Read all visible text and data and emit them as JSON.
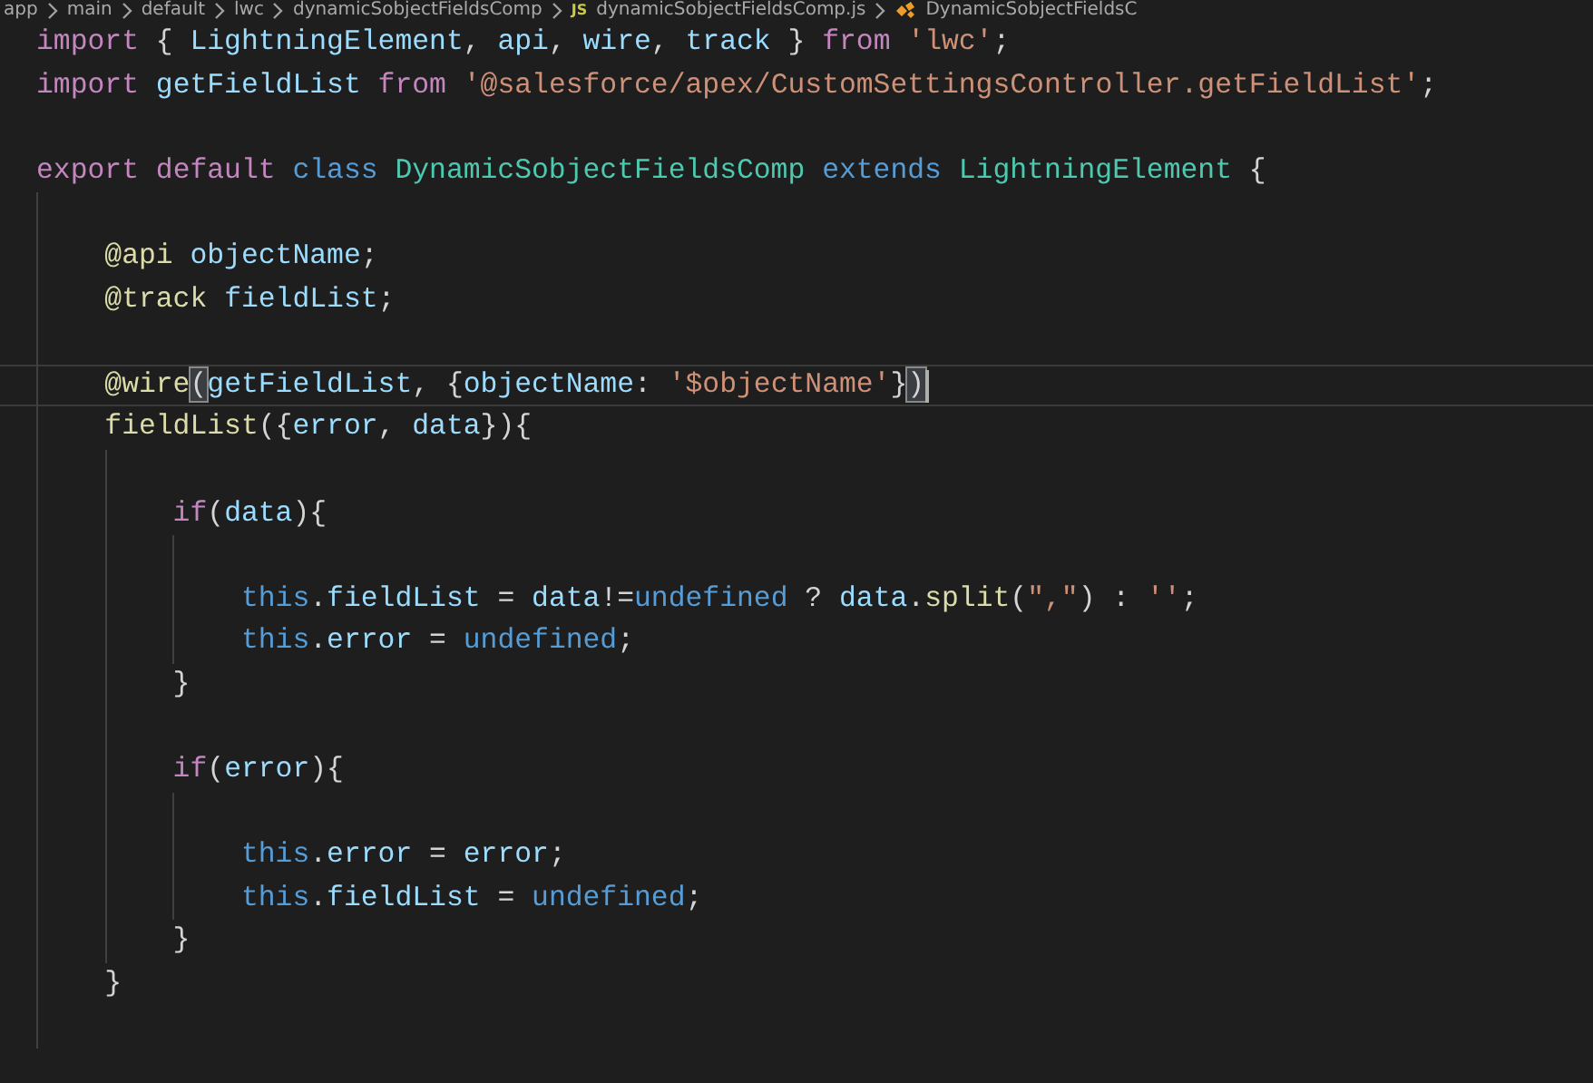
{
  "breadcrumb": [
    {
      "kind": "folder",
      "label": "app"
    },
    {
      "kind": "folder",
      "label": "main"
    },
    {
      "kind": "folder",
      "label": "default"
    },
    {
      "kind": "folder",
      "label": "lwc"
    },
    {
      "kind": "folder",
      "label": "dynamicSobjectFieldsComp"
    },
    {
      "kind": "file",
      "icon_text": "JS",
      "label": "dynamicSobjectFieldsComp.js"
    },
    {
      "kind": "symbol",
      "label": "DynamicSobjectFieldsC"
    }
  ],
  "editor": {
    "lines": [
      {
        "selected": false,
        "tokens": [
          {
            "text": "import",
            "kind": "keyword"
          },
          {
            "text": " { ",
            "kind": "plain"
          },
          {
            "text": "LightningElement",
            "kind": "variable"
          },
          {
            "text": ", ",
            "kind": "plain"
          },
          {
            "text": "api",
            "kind": "variable"
          },
          {
            "text": ", ",
            "kind": "plain"
          },
          {
            "text": "wire",
            "kind": "variable"
          },
          {
            "text": ", ",
            "kind": "plain"
          },
          {
            "text": "track",
            "kind": "variable"
          },
          {
            "text": " } ",
            "kind": "plain"
          },
          {
            "text": "from ",
            "kind": "keyword"
          },
          {
            "text": "'lwc'",
            "kind": "string"
          },
          {
            "text": ";",
            "kind": "plain"
          }
        ]
      },
      {
        "selected": false,
        "tokens": [
          {
            "text": "import ",
            "kind": "keyword"
          },
          {
            "text": "getFieldList ",
            "kind": "variable"
          },
          {
            "text": "from ",
            "kind": "keyword"
          },
          {
            "text": "'@salesforce/apex/CustomSettingsController.getFieldList'",
            "kind": "string"
          },
          {
            "text": ";",
            "kind": "plain"
          }
        ]
      },
      {
        "selected": false
      },
      {
        "selected": false,
        "tokens": [
          {
            "text": "export ",
            "kind": "keyword"
          },
          {
            "text": "default ",
            "kind": "keyword"
          },
          {
            "text": "class ",
            "kind": "storage"
          },
          {
            "text": "DynamicSobjectFieldsComp ",
            "kind": "type"
          },
          {
            "text": "extends ",
            "kind": "storage"
          },
          {
            "text": "LightningElement",
            "kind": "type"
          },
          {
            "text": " {",
            "kind": "plain"
          }
        ]
      },
      {
        "selected": false
      },
      {
        "selected": false,
        "tokens": [
          {
            "text": "    @api ",
            "kind": "function"
          },
          {
            "text": "objectName",
            "kind": "variable"
          },
          {
            "text": ";",
            "kind": "plain"
          }
        ]
      },
      {
        "selected": false,
        "tokens": [
          {
            "text": "    @track ",
            "kind": "function"
          },
          {
            "text": "fieldList",
            "kind": "variable"
          },
          {
            "text": ";",
            "kind": "plain"
          }
        ]
      },
      {
        "selected": false
      },
      {
        "selected": true,
        "tokens": [
          {
            "text": "    @wire",
            "kind": "function"
          },
          {
            "text": "(",
            "kind": "bracket-match"
          },
          {
            "text": "getFieldList",
            "kind": "variable"
          },
          {
            "text": ", {",
            "kind": "plain"
          },
          {
            "text": "objectName",
            "kind": "variable"
          },
          {
            "text": ": ",
            "kind": "plain"
          },
          {
            "text": "'$objectName'",
            "kind": "string"
          },
          {
            "text": "}",
            "kind": "plain"
          },
          {
            "text": ")",
            "kind": "bracket-match"
          }
        ]
      },
      {
        "selected": false,
        "tokens": [
          {
            "text": "    fieldList",
            "kind": "function"
          },
          {
            "text": "({",
            "kind": "plain"
          },
          {
            "text": "error",
            "kind": "variable"
          },
          {
            "text": ", ",
            "kind": "plain"
          },
          {
            "text": "data",
            "kind": "variable"
          },
          {
            "text": "}){",
            "kind": "plain"
          }
        ]
      },
      {
        "selected": false
      },
      {
        "selected": false,
        "tokens": [
          {
            "text": "        if",
            "kind": "keyword"
          },
          {
            "text": "(",
            "kind": "plain"
          },
          {
            "text": "data",
            "kind": "variable"
          },
          {
            "text": "){",
            "kind": "plain"
          }
        ]
      },
      {
        "selected": false
      },
      {
        "selected": false,
        "tokens": [
          {
            "text": "            this",
            "kind": "storage"
          },
          {
            "text": ".",
            "kind": "plain"
          },
          {
            "text": "fieldList",
            "kind": "variable"
          },
          {
            "text": " = ",
            "kind": "plain"
          },
          {
            "text": "data",
            "kind": "variable"
          },
          {
            "text": "!=",
            "kind": "plain"
          },
          {
            "text": "undefined",
            "kind": "storage"
          },
          {
            "text": " ? ",
            "kind": "plain"
          },
          {
            "text": "data",
            "kind": "variable"
          },
          {
            "text": ".",
            "kind": "plain"
          },
          {
            "text": "split",
            "kind": "function"
          },
          {
            "text": "(",
            "kind": "plain"
          },
          {
            "text": "\",\"",
            "kind": "string"
          },
          {
            "text": ") : ",
            "kind": "plain"
          },
          {
            "text": "''",
            "kind": "string"
          },
          {
            "text": ";",
            "kind": "plain"
          }
        ]
      },
      {
        "selected": false,
        "tokens": [
          {
            "text": "            this",
            "kind": "storage"
          },
          {
            "text": ".",
            "kind": "plain"
          },
          {
            "text": "error",
            "kind": "variable"
          },
          {
            "text": " = ",
            "kind": "plain"
          },
          {
            "text": "undefined",
            "kind": "storage"
          },
          {
            "text": ";",
            "kind": "plain"
          }
        ]
      },
      {
        "selected": false,
        "tokens": [
          {
            "text": "        }",
            "kind": "plain"
          }
        ]
      },
      {
        "selected": false
      },
      {
        "selected": false,
        "tokens": [
          {
            "text": "        if",
            "kind": "keyword"
          },
          {
            "text": "(",
            "kind": "plain"
          },
          {
            "text": "error",
            "kind": "variable"
          },
          {
            "text": "){",
            "kind": "plain"
          }
        ]
      },
      {
        "selected": false
      },
      {
        "selected": false,
        "tokens": [
          {
            "text": "            this",
            "kind": "storage"
          },
          {
            "text": ".",
            "kind": "plain"
          },
          {
            "text": "error",
            "kind": "variable"
          },
          {
            "text": " = ",
            "kind": "plain"
          },
          {
            "text": "error",
            "kind": "variable"
          },
          {
            "text": ";",
            "kind": "plain"
          }
        ]
      },
      {
        "selected": false,
        "tokens": [
          {
            "text": "            this",
            "kind": "storage"
          },
          {
            "text": ".",
            "kind": "plain"
          },
          {
            "text": "fieldList",
            "kind": "variable"
          },
          {
            "text": " = ",
            "kind": "plain"
          },
          {
            "text": "undefined",
            "kind": "storage"
          },
          {
            "text": ";",
            "kind": "plain"
          }
        ]
      },
      {
        "selected": false,
        "tokens": [
          {
            "text": "        }",
            "kind": "plain"
          }
        ]
      },
      {
        "selected": false,
        "tokens": [
          {
            "text": "    }",
            "kind": "plain"
          }
        ]
      },
      {
        "selected": false
      }
    ]
  }
}
